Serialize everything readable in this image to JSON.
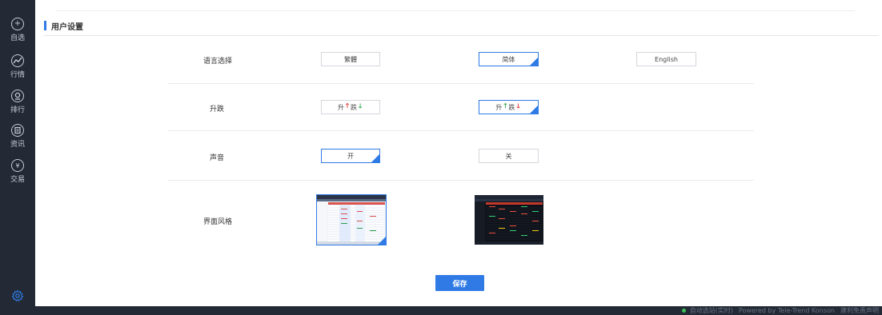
{
  "sidebar": {
    "items": [
      {
        "label": "自选",
        "icon": "plus-circle-icon"
      },
      {
        "label": "行情",
        "icon": "trend-chart-icon"
      },
      {
        "label": "排行",
        "icon": "ranking-icon"
      },
      {
        "label": "资讯",
        "icon": "news-icon"
      },
      {
        "label": "交易",
        "icon": "trade-icon"
      }
    ],
    "settings_icon": "gear-icon"
  },
  "section": {
    "title": "用户设置"
  },
  "rows": {
    "language": {
      "label": "语言选择",
      "options": [
        "繁體",
        "简体",
        "English"
      ],
      "selected": "简体"
    },
    "updown": {
      "label": "升跌",
      "options": [
        {
          "up": "升",
          "down": "跌"
        },
        {
          "up": "升",
          "down": "跌"
        }
      ],
      "selected_index": 1
    },
    "sound": {
      "label": "声音",
      "options": [
        "开",
        "关"
      ],
      "selected": "开"
    },
    "theme": {
      "label": "界面风格",
      "options": [
        "light-theme-preview",
        "dark-theme-preview"
      ],
      "selected_index": 0
    }
  },
  "save_label": "保存",
  "footer": {
    "status": "自动选站(实时)",
    "powered": "Powered by Tele-Trend Konson",
    "disclaimer": "建利免责声明"
  },
  "colors": {
    "accent": "#2f7ae5",
    "sidebar_bg": "#232a36",
    "up_red": "#e62b2b",
    "down_green": "#1ea33a"
  }
}
